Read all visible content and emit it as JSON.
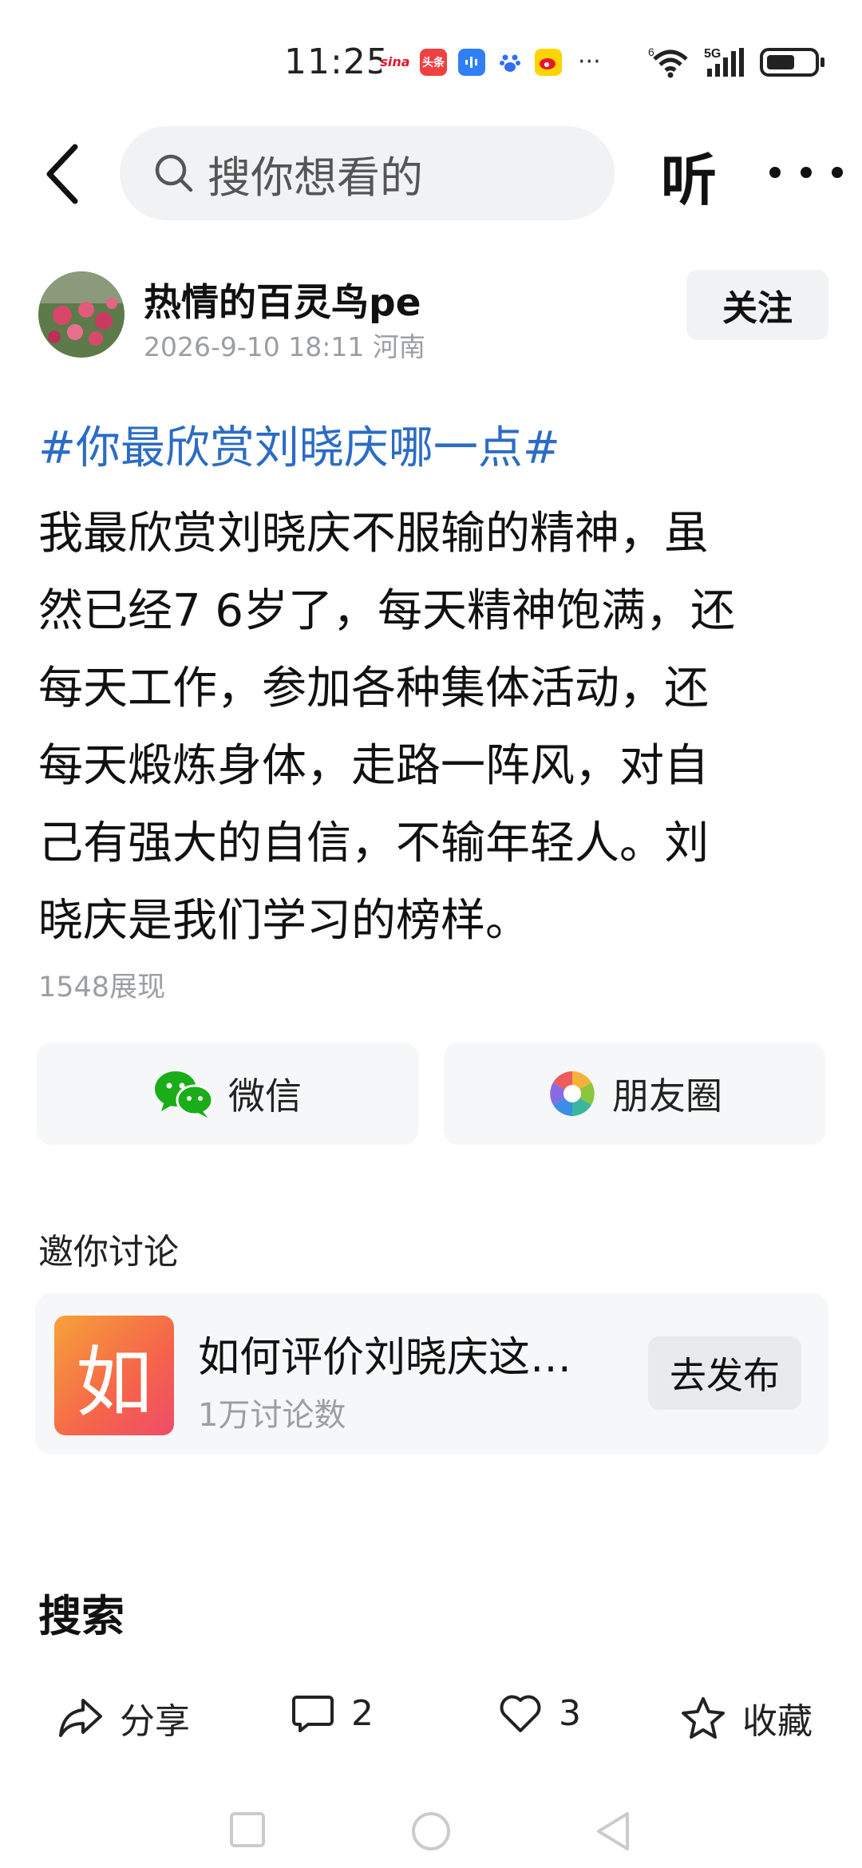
{
  "status_bar": {
    "time": "11:25",
    "app_icons": [
      "sina-icon",
      "toutiao-icon",
      "voice-app-icon",
      "baidu-icon",
      "weibo-icon"
    ],
    "overflow": "···",
    "battery_color": "#222222"
  },
  "header": {
    "search_placeholder": "搜你想看的",
    "listen_label": "听"
  },
  "author": {
    "name": "热情的百灵鸟pe",
    "meta": "2026-9-10 18:11 河南",
    "follow_label": "关注"
  },
  "post": {
    "hashtag": "#你最欣赏刘晓庆哪一点#",
    "hashtag_color": "#2b6cc4",
    "lines": [
      "我最欣赏刘晓庆不服输的精神，虽",
      "然已经7 6岁了，每天精神饱满，还",
      "每天工作，参加各种集体活动，还",
      "每天煅炼身体，走路一阵风，对自",
      "己有强大的自信，不输年轻人。刘",
      "晓庆是我们学习的榜样。"
    ],
    "views": "1548展现"
  },
  "share": {
    "wechat_label": "微信",
    "moments_label": "朋友圈"
  },
  "invite": {
    "title": "邀你讨论",
    "topic_logo_char": "如",
    "topic_title": "如何评价刘晓庆这…",
    "topic_count": "1万讨论数",
    "publish_label": "去发布"
  },
  "search_section": {
    "label": "搜索"
  },
  "actions": {
    "share_label": "分享",
    "comment_count": "2",
    "like_count": "3",
    "favorite_label": "收藏"
  }
}
